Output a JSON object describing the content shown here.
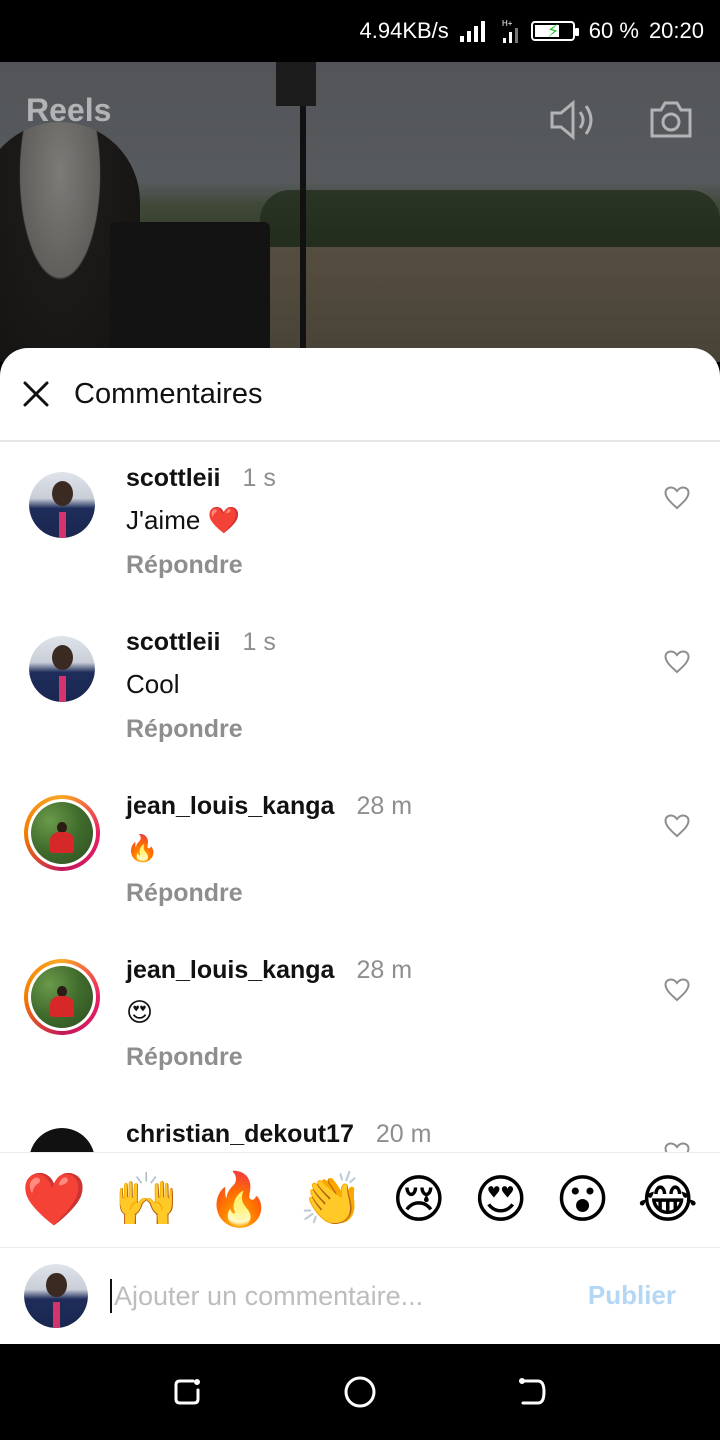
{
  "status_bar": {
    "speed": "4.94KB/s",
    "battery_percent": "60 %",
    "time": "20:20"
  },
  "video": {
    "title": "Reels",
    "icons": [
      "volume-icon",
      "camera-icon"
    ]
  },
  "sheet": {
    "title": "Commentaires"
  },
  "comments": [
    {
      "user": "scottleii",
      "time": "1 s",
      "text": "J'aime ❤️",
      "reply": "Répondre",
      "avatar": "suit",
      "story_ring": false
    },
    {
      "user": "scottleii",
      "time": "1 s",
      "text": "Cool",
      "reply": "Répondre",
      "avatar": "suit",
      "story_ring": false
    },
    {
      "user": "jean_louis_kanga",
      "time": "28 m",
      "text": "🔥",
      "reply": "Répondre",
      "avatar": "forest",
      "story_ring": true
    },
    {
      "user": "jean_louis_kanga",
      "time": "28 m",
      "text": "😍",
      "reply": "Répondre",
      "avatar": "forest",
      "story_ring": true
    },
    {
      "user": "christian_dekout17",
      "time": "20 m",
      "text": "",
      "reply": "",
      "avatar": "dark",
      "story_ring": false
    }
  ],
  "emoji_bar": [
    "❤️",
    "🙌",
    "🔥",
    "👏",
    "😢",
    "😍",
    "😮",
    "😂"
  ],
  "composer": {
    "placeholder": "Ajouter un commentaire...",
    "publish_label": "Publier"
  },
  "navbar": [
    "recent-apps-icon",
    "home-icon",
    "back-icon"
  ],
  "colors": {
    "publish_disabled": "#b3d7f5",
    "muted_text": "#8e8e8e",
    "story_ring": "#e91e63"
  }
}
